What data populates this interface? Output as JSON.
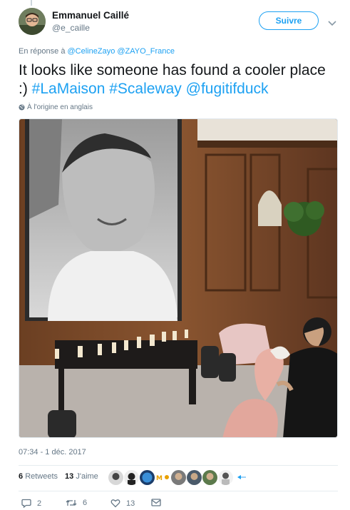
{
  "author": {
    "name": "Emmanuel Caillé",
    "handle": "@e_caille"
  },
  "follow_label": "Suivre",
  "reply": {
    "prefix": "En réponse à",
    "users": [
      "@CelineZayo",
      "@ZAYO_France"
    ]
  },
  "tweet": {
    "text_plain": "It looks like someone has found a cooler place :)",
    "hashtags": [
      "#LaMaison",
      "#Scaleway"
    ],
    "mention": "@fugitifduck"
  },
  "translate_label": "À l'origine en anglais",
  "timestamp": "07:34 - 1 déc. 2017",
  "stats": {
    "retweets": "6",
    "retweets_label": "Retweets",
    "likes": "13",
    "likes_label": "J'aime"
  },
  "actions": {
    "replies": "2",
    "retweets": "6",
    "likes": "13"
  },
  "colors": {
    "accent": "#1da1f2",
    "secondary_text": "#657786"
  }
}
